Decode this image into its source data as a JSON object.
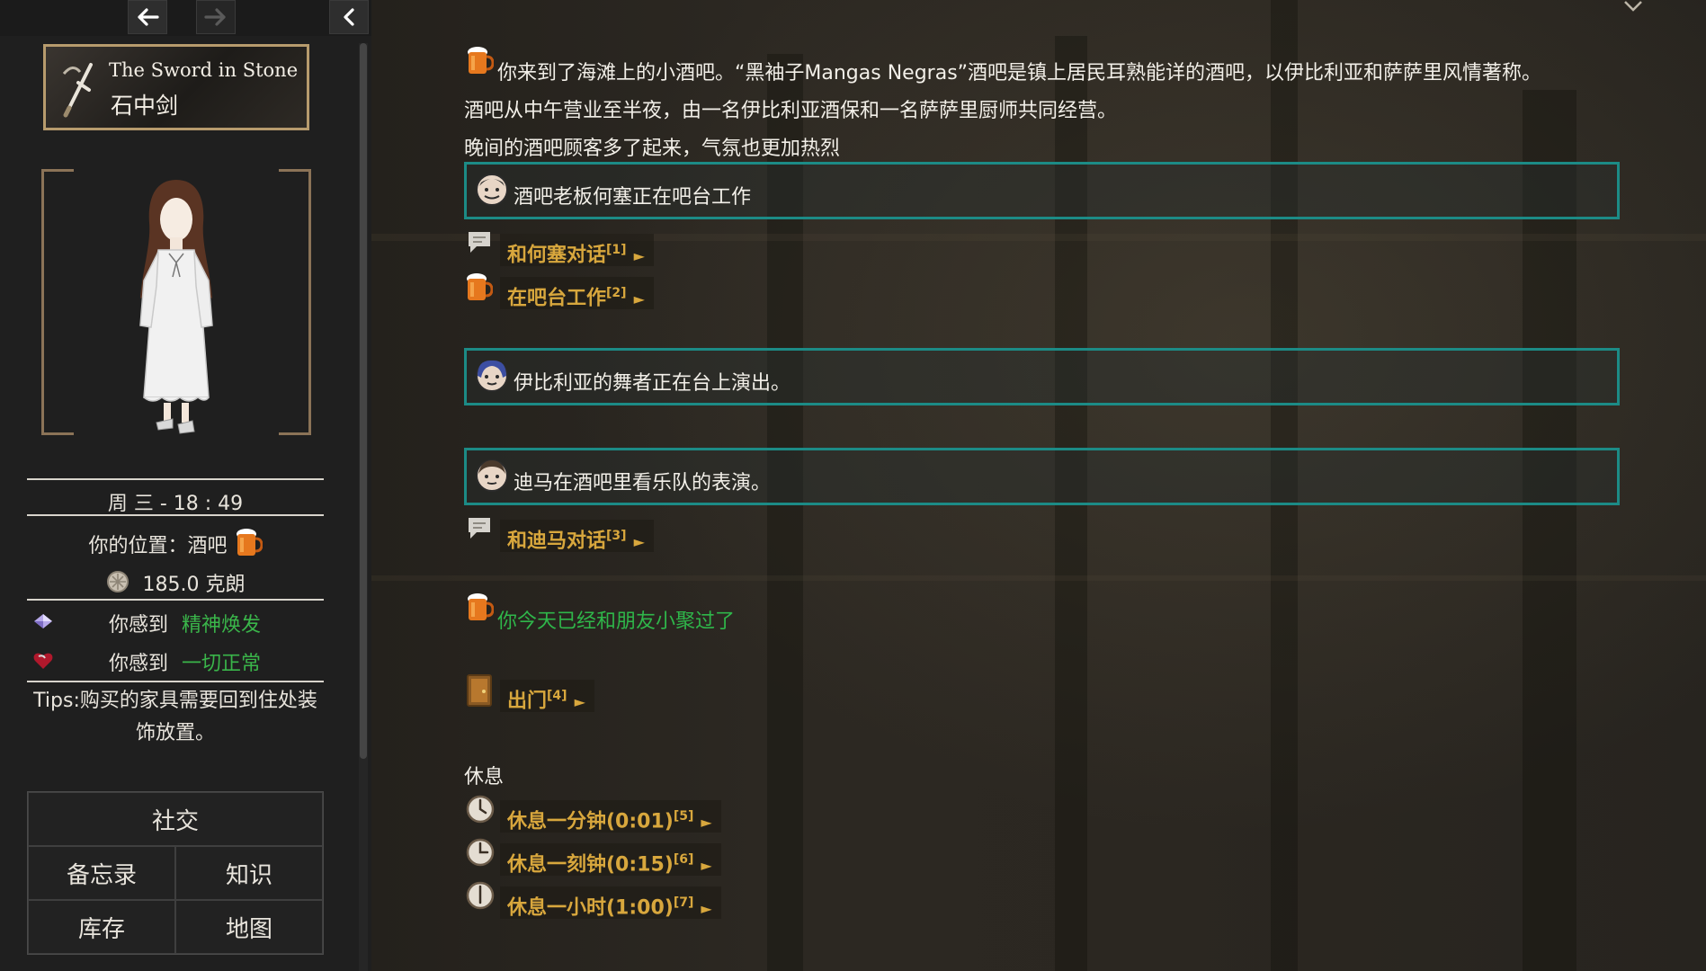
{
  "sidebar": {
    "nav": {
      "back_icon": "arrow-left-icon",
      "forward_icon": "arrow-right-icon",
      "collapse_icon": "chevron-left-icon"
    },
    "logo": {
      "title_en": "The Sword in Stone",
      "title_cn": "石中剑"
    },
    "datetime": "周 三 - 18 : 49",
    "location": {
      "label": "你的位置：酒吧",
      "icon": "beer-mug-icon"
    },
    "money": {
      "value": "185.0 克朗",
      "icon": "coin-icon"
    },
    "status": [
      {
        "icon": "crystal-icon",
        "label": "你感到",
        "value": "精神焕发"
      },
      {
        "icon": "heart-icon",
        "label": "你感到",
        "value": "一切正常"
      }
    ],
    "tips": "Tips:购买的家具需要回到住处装饰放置。",
    "menu": {
      "social": "社交",
      "memo": "备忘录",
      "knowledge": "知识",
      "inventory": "库存",
      "map": "地图"
    }
  },
  "main": {
    "intro": [
      "你来到了海滩上的小酒吧。“黑袖子Mangas Negras”酒吧是镇上居民耳熟能详的酒吧，以伊比利亚和萨萨里风情著称。",
      "酒吧从中午营业至半夜，由一名伊比利亚酒保和一名萨萨里厨师共同经营。",
      "晚间的酒吧顾客多了起来，气氛也更加热烈"
    ],
    "npcs": [
      {
        "text": "酒吧老板何塞正在吧台工作",
        "icon": "bartender-portrait-icon",
        "actions": [
          {
            "label": "和何塞对话",
            "key": "[1]",
            "icon": "speech-bubble-icon"
          },
          {
            "label": "在吧台工作",
            "key": "[2]",
            "icon": "beer-mug-icon"
          }
        ]
      },
      {
        "text": "伊比利亚的舞者正在台上演出。",
        "icon": "dancer-portrait-icon",
        "actions": []
      },
      {
        "text": "迪马在酒吧里看乐队的表演。",
        "icon": "dima-portrait-icon",
        "actions": [
          {
            "label": "和迪马对话",
            "key": "[3]",
            "icon": "speech-bubble-icon"
          }
        ]
      }
    ],
    "info": {
      "text": "你今天已经和朋友小聚过了",
      "icon": "beer-mug-icon"
    },
    "exit": {
      "label": "出门",
      "key": "[4]",
      "icon": "door-icon"
    },
    "rest_heading": "休息",
    "rest_actions": [
      {
        "label": "休息一分钟(0:01)",
        "key": "[5]",
        "icon": "clock-icon"
      },
      {
        "label": "休息一刻钟(0:15)",
        "key": "[6]",
        "icon": "clock-icon"
      },
      {
        "label": "休息一小时(1:00)",
        "key": "[7]",
        "icon": "clock-icon"
      }
    ],
    "arrow_glyph": "►"
  },
  "colors": {
    "teal_border": "#1c8b86",
    "link_gold": "#d8a73d",
    "status_green": "#3ab54a",
    "frame_tan": "#b79b6d"
  }
}
